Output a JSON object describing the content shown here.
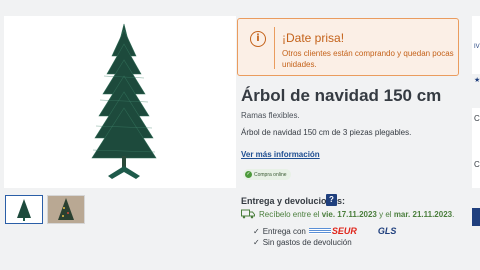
{
  "colors": {
    "alert_text": "#c4621a",
    "alert_bg": "#fbefe6",
    "alert_border": "#ea9c5e",
    "link": "#1e4e91",
    "delivery_green": "#4a7e3c",
    "help_button": "#1f3f7d",
    "seur_red": "#e0251b"
  },
  "alert": {
    "icon": "info-icon",
    "title": "¡Date prisa!",
    "text": "Otros clientes están comprando y quedan pocas unidades."
  },
  "product": {
    "title": "Árbol de navidad 150 cm",
    "subtitle": "Ramas flexibles.",
    "description": "Árbol de navidad 150 cm de 3 piezas plegables.",
    "more_info_link": "Ver más información",
    "online_badge": "Compra online"
  },
  "delivery": {
    "heading": "Entrega y devoluciones:",
    "help_label": "?",
    "receive_prefix": "Recíbelo entre el",
    "date_from": "vie. 17.11.2023",
    "receive_middle": "y el",
    "date_to": "mar. 21.11.2023",
    "receive_suffix": ".",
    "carriers_label": "Entrega con",
    "seur_logo": "SEUR",
    "gls_logo": "GLS",
    "returns_label": "Sin gastos de devolución",
    "check_glyph": "✓"
  },
  "right_sidebar": {
    "text_1": "IV",
    "text_2": "★",
    "text_3": "C",
    "text_4": "C"
  },
  "gallery": {
    "thumbnails": [
      "christmas-tree-product",
      "christmas-tree-decorated"
    ]
  }
}
